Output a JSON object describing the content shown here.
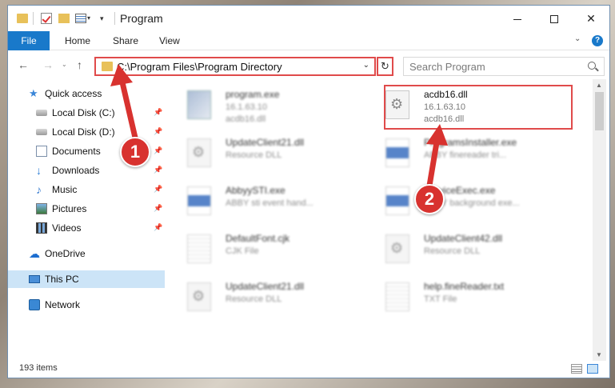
{
  "window": {
    "title": "Program",
    "controls": {
      "minimize": "minimize",
      "maximize": "maximize",
      "close": "✕"
    }
  },
  "ribbon": {
    "file": "File",
    "tabs": [
      "Home",
      "Share",
      "View"
    ],
    "toggle": "⌄",
    "help": "?"
  },
  "nav": {
    "back": "←",
    "forward": "→",
    "recent": "⌄",
    "up": "↑",
    "address": "C:\\Program Files\\Program Directory",
    "address_dd": "⌄",
    "refresh": "↻",
    "search_placeholder": "Search Program"
  },
  "sidebar": {
    "items": [
      {
        "label": "Quick access",
        "icon": "star-icon",
        "pinned": false
      },
      {
        "label": "Local Disk (C:)",
        "icon": "drive-icon",
        "pinned": true
      },
      {
        "label": "Local Disk (D:)",
        "icon": "drive-icon",
        "pinned": true
      },
      {
        "label": "Documents",
        "icon": "documents-icon",
        "pinned": true
      },
      {
        "label": "Downloads",
        "icon": "download-icon",
        "pinned": true
      },
      {
        "label": "Music",
        "icon": "music-icon",
        "pinned": true
      },
      {
        "label": "Pictures",
        "icon": "pictures-icon",
        "pinned": true
      },
      {
        "label": "Videos",
        "icon": "videos-icon",
        "pinned": true
      },
      {
        "label": "OneDrive",
        "icon": "cloud-icon",
        "pinned": false
      },
      {
        "label": "This PC",
        "icon": "computer-icon",
        "pinned": false,
        "selected": true
      },
      {
        "label": "Network",
        "icon": "network-icon",
        "pinned": false
      }
    ],
    "pin_glyph": "📌"
  },
  "files": [
    {
      "name": "program.exe",
      "line2": "16.1.63.10",
      "line3": "acdb16.dll",
      "icon": "setup",
      "blurred": true
    },
    {
      "name": "acdb16.dll",
      "line2": "16.1.63.10",
      "line3": "acdb16.dll",
      "icon": "gear",
      "blurred": false,
      "highlighted": true
    },
    {
      "name": "UpdateClient21.dll",
      "line2": "Resource DLL",
      "line3": "",
      "icon": "gear",
      "blurred": true
    },
    {
      "name": "ProgramsInstaller.exe",
      "line2": "ABBY finereader tri...",
      "line3": "",
      "icon": "exe",
      "blurred": true
    },
    {
      "name": "AbbyySTI.exe",
      "line2": "ABBY sti event hand...",
      "line3": "",
      "icon": "exe",
      "blurred": true
    },
    {
      "name": "ServiceExec.exe",
      "line2": "ABBY background exe...",
      "line3": "",
      "icon": "exe",
      "blurred": true
    },
    {
      "name": "DefaultFont.cjk",
      "line2": "CJK File",
      "line3": "",
      "icon": "txt",
      "blurred": true
    },
    {
      "name": "UpdateClient42.dll",
      "line2": "Resource DLL",
      "line3": "",
      "icon": "gear",
      "blurred": true
    },
    {
      "name": "UpdateClient21.dll",
      "line2": "Resource DLL",
      "line3": "",
      "icon": "gear",
      "blurred": true
    },
    {
      "name": "help.fineReader.txt",
      "line2": "TXT File",
      "line3": "",
      "icon": "txt",
      "blurred": true
    }
  ],
  "status": {
    "count": "193 items"
  },
  "callouts": {
    "one": "1",
    "two": "2"
  },
  "colors": {
    "accent": "#1979ca",
    "annotation": "#e04b4b",
    "selected": "#cce4f7"
  }
}
